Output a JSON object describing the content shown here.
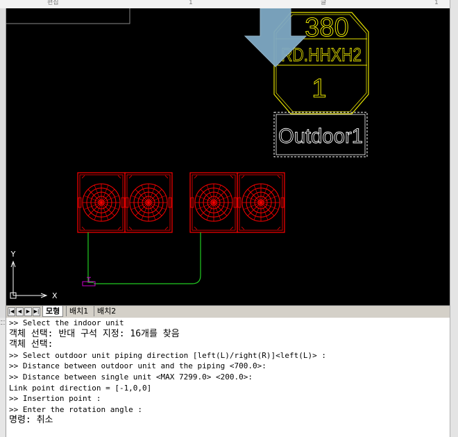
{
  "top_strip": {
    "fragments": [
      "편집",
      "1",
      "글",
      "1"
    ]
  },
  "canvas": {
    "nameplate": {
      "line1": "380",
      "line2": "RD.HHXH2",
      "line3": "1",
      "color": "#e8e400"
    },
    "outdoor_label": "Outdoor1",
    "indoor_units_color": "#ff0000",
    "piping_color": "#22cc22",
    "marker_color": "#cc00cc",
    "arrow_color": "#7fa9c4",
    "ucs": {
      "y_label": "Y",
      "x_label": "X"
    }
  },
  "tabs": {
    "active": "모형",
    "items": [
      "배치1",
      "배치2"
    ]
  },
  "command_lines": [
    ">> Select the indoor unit",
    "객체 선택: 반대 구석 지정: 16개를 찾음",
    "객체 선택:",
    ">> Select outdoor unit piping direction [left(L)/right(R)]<left(L)> :",
    ">> Distance between outdoor unit and the piping <700.0>:",
    ">> Distance between single unit <MAX 7299.0> <200.0>:",
    "Link point direction = [-1,0,0]",
    ">> Insertion point :",
    ">> Enter the rotation angle :",
    "명령: 취소"
  ]
}
